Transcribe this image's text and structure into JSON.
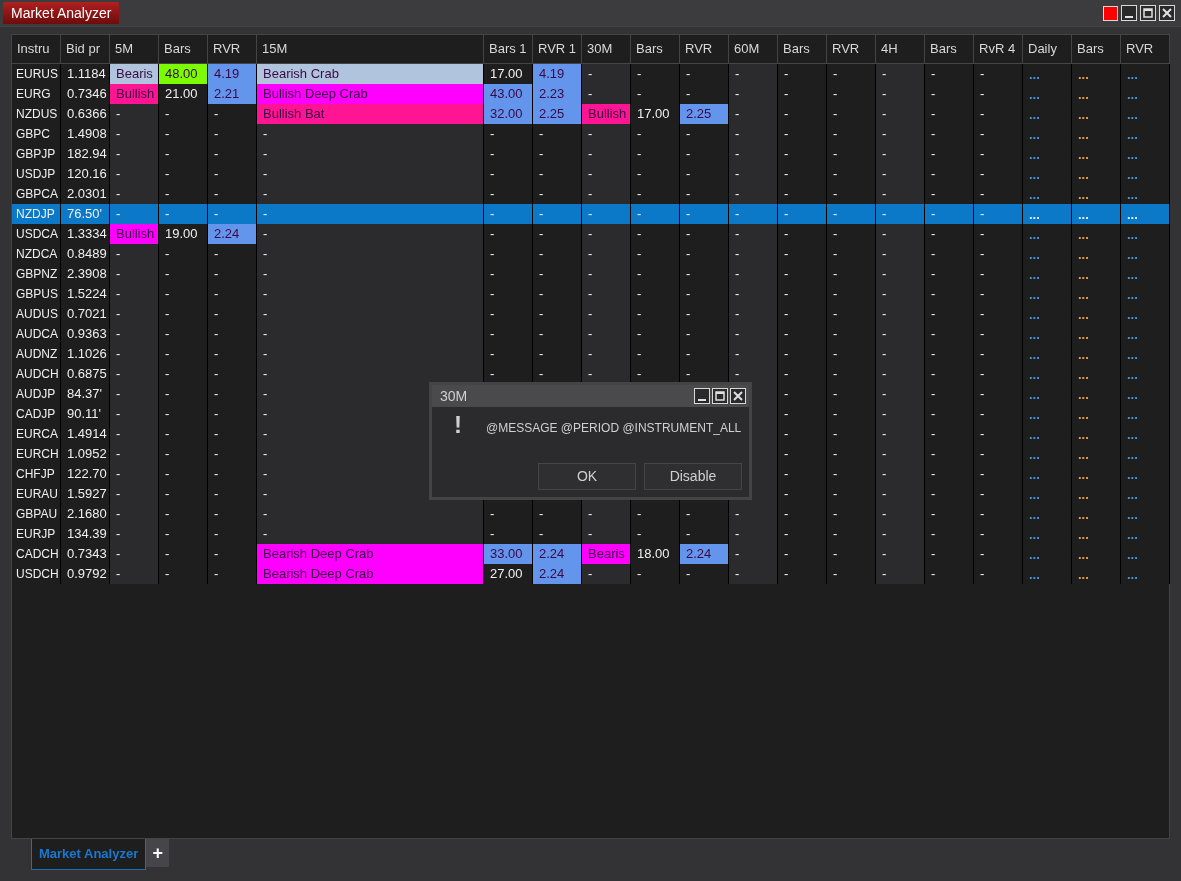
{
  "window": {
    "title": "Market Analyzer"
  },
  "table": {
    "columns": [
      {
        "label": "Instru",
        "kind": "key"
      },
      {
        "label": "Bid pr",
        "kind": "value"
      },
      {
        "label": "5M",
        "kind": "pattern"
      },
      {
        "label": "Bars",
        "kind": "value"
      },
      {
        "label": "RVR",
        "kind": "value"
      },
      {
        "label": "15M",
        "kind": "pattern"
      },
      {
        "label": "Bars 1",
        "kind": "value"
      },
      {
        "label": "RVR 1",
        "kind": "value"
      },
      {
        "label": "30M",
        "kind": "pattern"
      },
      {
        "label": "Bars",
        "kind": "value"
      },
      {
        "label": "RVR",
        "kind": "value"
      },
      {
        "label": "60M",
        "kind": "pattern"
      },
      {
        "label": "Bars",
        "kind": "value"
      },
      {
        "label": "RVR",
        "kind": "value"
      },
      {
        "label": "4H",
        "kind": "pattern"
      },
      {
        "label": "Bars",
        "kind": "value"
      },
      {
        "label": "RvR 4",
        "kind": "value"
      },
      {
        "label": "Daily",
        "kind": "value",
        "color": "#3d9be9"
      },
      {
        "label": "Bars",
        "kind": "value",
        "color": "#f0a030"
      },
      {
        "label": "RVR",
        "kind": "value",
        "color": "#3d9be9"
      }
    ],
    "rows": [
      {
        "selected": false,
        "cells": [
          "EURUS",
          "1.1184",
          {
            "text": "Bearis",
            "color": "#b0c4de"
          },
          {
            "text": "48.00",
            "color": "#7cfc00"
          },
          {
            "text": "4.19",
            "color": "#6495ed"
          },
          {
            "text": "Bearish Crab",
            "color": "#b0c4de"
          },
          "17.00",
          {
            "text": "4.19",
            "color": "#6495ed"
          },
          "-",
          "-",
          "-",
          "-",
          "-",
          "-",
          "-",
          "-",
          "-",
          "...",
          "...",
          "..."
        ]
      },
      {
        "selected": false,
        "cells": [
          "EURG",
          "0.7346",
          {
            "text": "Bullish",
            "color": "#ff1493"
          },
          "21.00",
          {
            "text": "2.21",
            "color": "#6495ed"
          },
          {
            "text": "Bullish Deep Crab",
            "color": "#ff00ff"
          },
          {
            "text": "43.00",
            "color": "#6495ed"
          },
          {
            "text": "2.23",
            "color": "#6495ed"
          },
          "-",
          "-",
          "-",
          "-",
          "-",
          "-",
          "-",
          "-",
          "-",
          "...",
          "...",
          "..."
        ]
      },
      {
        "selected": false,
        "cells": [
          "NZDUS",
          "0.6366",
          "-",
          "-",
          "-",
          {
            "text": "Bullish Bat",
            "color": "#ff1493"
          },
          {
            "text": "32.00",
            "color": "#6495ed"
          },
          {
            "text": "2.25",
            "color": "#6495ed"
          },
          {
            "text": "Bullish",
            "color": "#ff1493"
          },
          "17.00",
          {
            "text": "2.25",
            "color": "#6495ed"
          },
          "-",
          "-",
          "-",
          "-",
          "-",
          "-",
          "...",
          "...",
          "..."
        ]
      },
      {
        "selected": false,
        "cells": [
          "GBPC",
          "1.4908",
          "-",
          "-",
          "-",
          "-",
          "-",
          "-",
          "-",
          "-",
          "-",
          "-",
          "-",
          "-",
          "-",
          "-",
          "-",
          "...",
          "...",
          "..."
        ]
      },
      {
        "selected": false,
        "cells": [
          "GBPJP",
          "182.94",
          "-",
          "-",
          "-",
          "-",
          "-",
          "-",
          "-",
          "-",
          "-",
          "-",
          "-",
          "-",
          "-",
          "-",
          "-",
          "...",
          "...",
          "..."
        ]
      },
      {
        "selected": false,
        "cells": [
          "USDJP",
          "120.16",
          "-",
          "-",
          "-",
          "-",
          "-",
          "-",
          "-",
          "-",
          "-",
          "-",
          "-",
          "-",
          "-",
          "-",
          "-",
          "...",
          "...",
          "..."
        ]
      },
      {
        "selected": false,
        "cells": [
          "GBPCA",
          "2.0301",
          "-",
          "-",
          "-",
          "-",
          "-",
          "-",
          "-",
          "-",
          "-",
          "-",
          "-",
          "-",
          "-",
          "-",
          "-",
          "...",
          "...",
          "..."
        ]
      },
      {
        "selected": true,
        "cells": [
          "NZDJP",
          "76.50'",
          "-",
          "-",
          "-",
          "-",
          "-",
          "-",
          "-",
          "-",
          "-",
          "-",
          "-",
          "-",
          "-",
          "-",
          "-",
          "...",
          "...",
          "..."
        ]
      },
      {
        "selected": false,
        "cells": [
          "USDCA",
          "1.3334",
          {
            "text": "Bullish",
            "color": "#ff00ff"
          },
          "19.00",
          {
            "text": "2.24",
            "color": "#6495ed"
          },
          "-",
          "-",
          "-",
          "-",
          "-",
          "-",
          "-",
          "-",
          "-",
          "-",
          "-",
          "-",
          "...",
          "...",
          "..."
        ]
      },
      {
        "selected": false,
        "cells": [
          "NZDCA",
          "0.8489",
          "-",
          "-",
          "-",
          "-",
          "-",
          "-",
          "-",
          "-",
          "-",
          "-",
          "-",
          "-",
          "-",
          "-",
          "-",
          "...",
          "...",
          "..."
        ]
      },
      {
        "selected": false,
        "cells": [
          "GBPNZ",
          "2.3908",
          "-",
          "-",
          "-",
          "-",
          "-",
          "-",
          "-",
          "-",
          "-",
          "-",
          "-",
          "-",
          "-",
          "-",
          "-",
          "...",
          "...",
          "..."
        ]
      },
      {
        "selected": false,
        "cells": [
          "GBPUS",
          "1.5224",
          "-",
          "-",
          "-",
          "-",
          "-",
          "-",
          "-",
          "-",
          "-",
          "-",
          "-",
          "-",
          "-",
          "-",
          "-",
          "...",
          "...",
          "..."
        ]
      },
      {
        "selected": false,
        "cells": [
          "AUDUS",
          "0.7021",
          "-",
          "-",
          "-",
          "-",
          "-",
          "-",
          "-",
          "-",
          "-",
          "-",
          "-",
          "-",
          "-",
          "-",
          "-",
          "...",
          "...",
          "..."
        ]
      },
      {
        "selected": false,
        "cells": [
          "AUDCA",
          "0.9363",
          "-",
          "-",
          "-",
          "-",
          "-",
          "-",
          "-",
          "-",
          "-",
          "-",
          "-",
          "-",
          "-",
          "-",
          "-",
          "...",
          "...",
          "..."
        ]
      },
      {
        "selected": false,
        "cells": [
          "AUDNZ",
          "1.1026",
          "-",
          "-",
          "-",
          "-",
          "-",
          "-",
          "-",
          "-",
          "-",
          "-",
          "-",
          "-",
          "-",
          "-",
          "-",
          "...",
          "...",
          "..."
        ]
      },
      {
        "selected": false,
        "cells": [
          "AUDCH",
          "0.6875",
          "-",
          "-",
          "-",
          "-",
          "-",
          "-",
          "-",
          "-",
          "-",
          "-",
          "-",
          "-",
          "-",
          "-",
          "-",
          "...",
          "...",
          "..."
        ]
      },
      {
        "selected": false,
        "cells": [
          "AUDJP",
          "84.37'",
          "-",
          "-",
          "-",
          "-",
          null,
          null,
          null,
          null,
          null,
          null,
          "-",
          "-",
          "-",
          "-",
          "-",
          "...",
          "...",
          "..."
        ]
      },
      {
        "selected": false,
        "cells": [
          "CADJP",
          "90.11'",
          "-",
          "-",
          "-",
          "-",
          null,
          null,
          null,
          null,
          null,
          null,
          "-",
          "-",
          "-",
          "-",
          "-",
          "...",
          "...",
          "..."
        ]
      },
      {
        "selected": false,
        "cells": [
          "EURCA",
          "1.4914",
          "-",
          "-",
          "-",
          "-",
          null,
          null,
          null,
          null,
          null,
          null,
          "-",
          "-",
          "-",
          "-",
          "-",
          "...",
          "...",
          "..."
        ]
      },
      {
        "selected": false,
        "cells": [
          "EURCH",
          "1.0952",
          "-",
          "-",
          "-",
          "-",
          null,
          null,
          null,
          null,
          null,
          null,
          "-",
          "-",
          "-",
          "-",
          "-",
          "...",
          "...",
          "..."
        ]
      },
      {
        "selected": false,
        "cells": [
          "CHFJP",
          "122.70",
          "-",
          "-",
          "-",
          "-",
          null,
          null,
          null,
          null,
          null,
          null,
          "-",
          "-",
          "-",
          "-",
          "-",
          "...",
          "...",
          "..."
        ]
      },
      {
        "selected": false,
        "cells": [
          "EURAU",
          "1.5927",
          "-",
          "-",
          "-",
          "-",
          null,
          null,
          null,
          null,
          null,
          null,
          "-",
          "-",
          "-",
          "-",
          "-",
          "...",
          "...",
          "..."
        ]
      },
      {
        "selected": false,
        "cells": [
          "GBPAU",
          "2.1680",
          "-",
          "-",
          "-",
          "-",
          "-",
          "-",
          "-",
          "-",
          "-",
          "-",
          "-",
          "-",
          "-",
          "-",
          "-",
          "...",
          "...",
          "..."
        ]
      },
      {
        "selected": false,
        "cells": [
          "EURJP",
          "134.39",
          "-",
          "-",
          "-",
          "-",
          "-",
          "-",
          "-",
          "-",
          "-",
          "-",
          "-",
          "-",
          "-",
          "-",
          "-",
          "...",
          "...",
          "..."
        ]
      },
      {
        "selected": false,
        "cells": [
          "CADCH",
          "0.7343",
          "-",
          "-",
          "-",
          {
            "text": "Bearish Deep Crab",
            "color": "#ff00ff"
          },
          {
            "text": "33.00",
            "color": "#6495ed"
          },
          {
            "text": "2.24",
            "color": "#6495ed"
          },
          {
            "text": "Bearis",
            "color": "#ff00ff"
          },
          "18.00",
          {
            "text": "2.24",
            "color": "#6495ed"
          },
          "-",
          "-",
          "-",
          "-",
          "-",
          "-",
          "...",
          "...",
          "..."
        ]
      },
      {
        "selected": false,
        "cells": [
          "USDCH",
          "0.9792",
          "-",
          "-",
          "-",
          {
            "text": "Bearish Deep Crab",
            "color": "#ff00ff"
          },
          "27.00",
          {
            "text": "2.24",
            "color": "#6495ed"
          },
          "-",
          "-",
          "-",
          "-",
          "-",
          "-",
          "-",
          "-",
          "-",
          "...",
          "...",
          "..."
        ]
      }
    ]
  },
  "dialog": {
    "title": "30M",
    "icon": "!",
    "message": "@MESSAGE @PERIOD @INSTRUMENT_ALL",
    "buttons": [
      "OK",
      "Disable"
    ]
  },
  "bottom_tabs": [
    {
      "label": "Market Analyzer",
      "selected": true
    }
  ],
  "add_tab": "+"
}
